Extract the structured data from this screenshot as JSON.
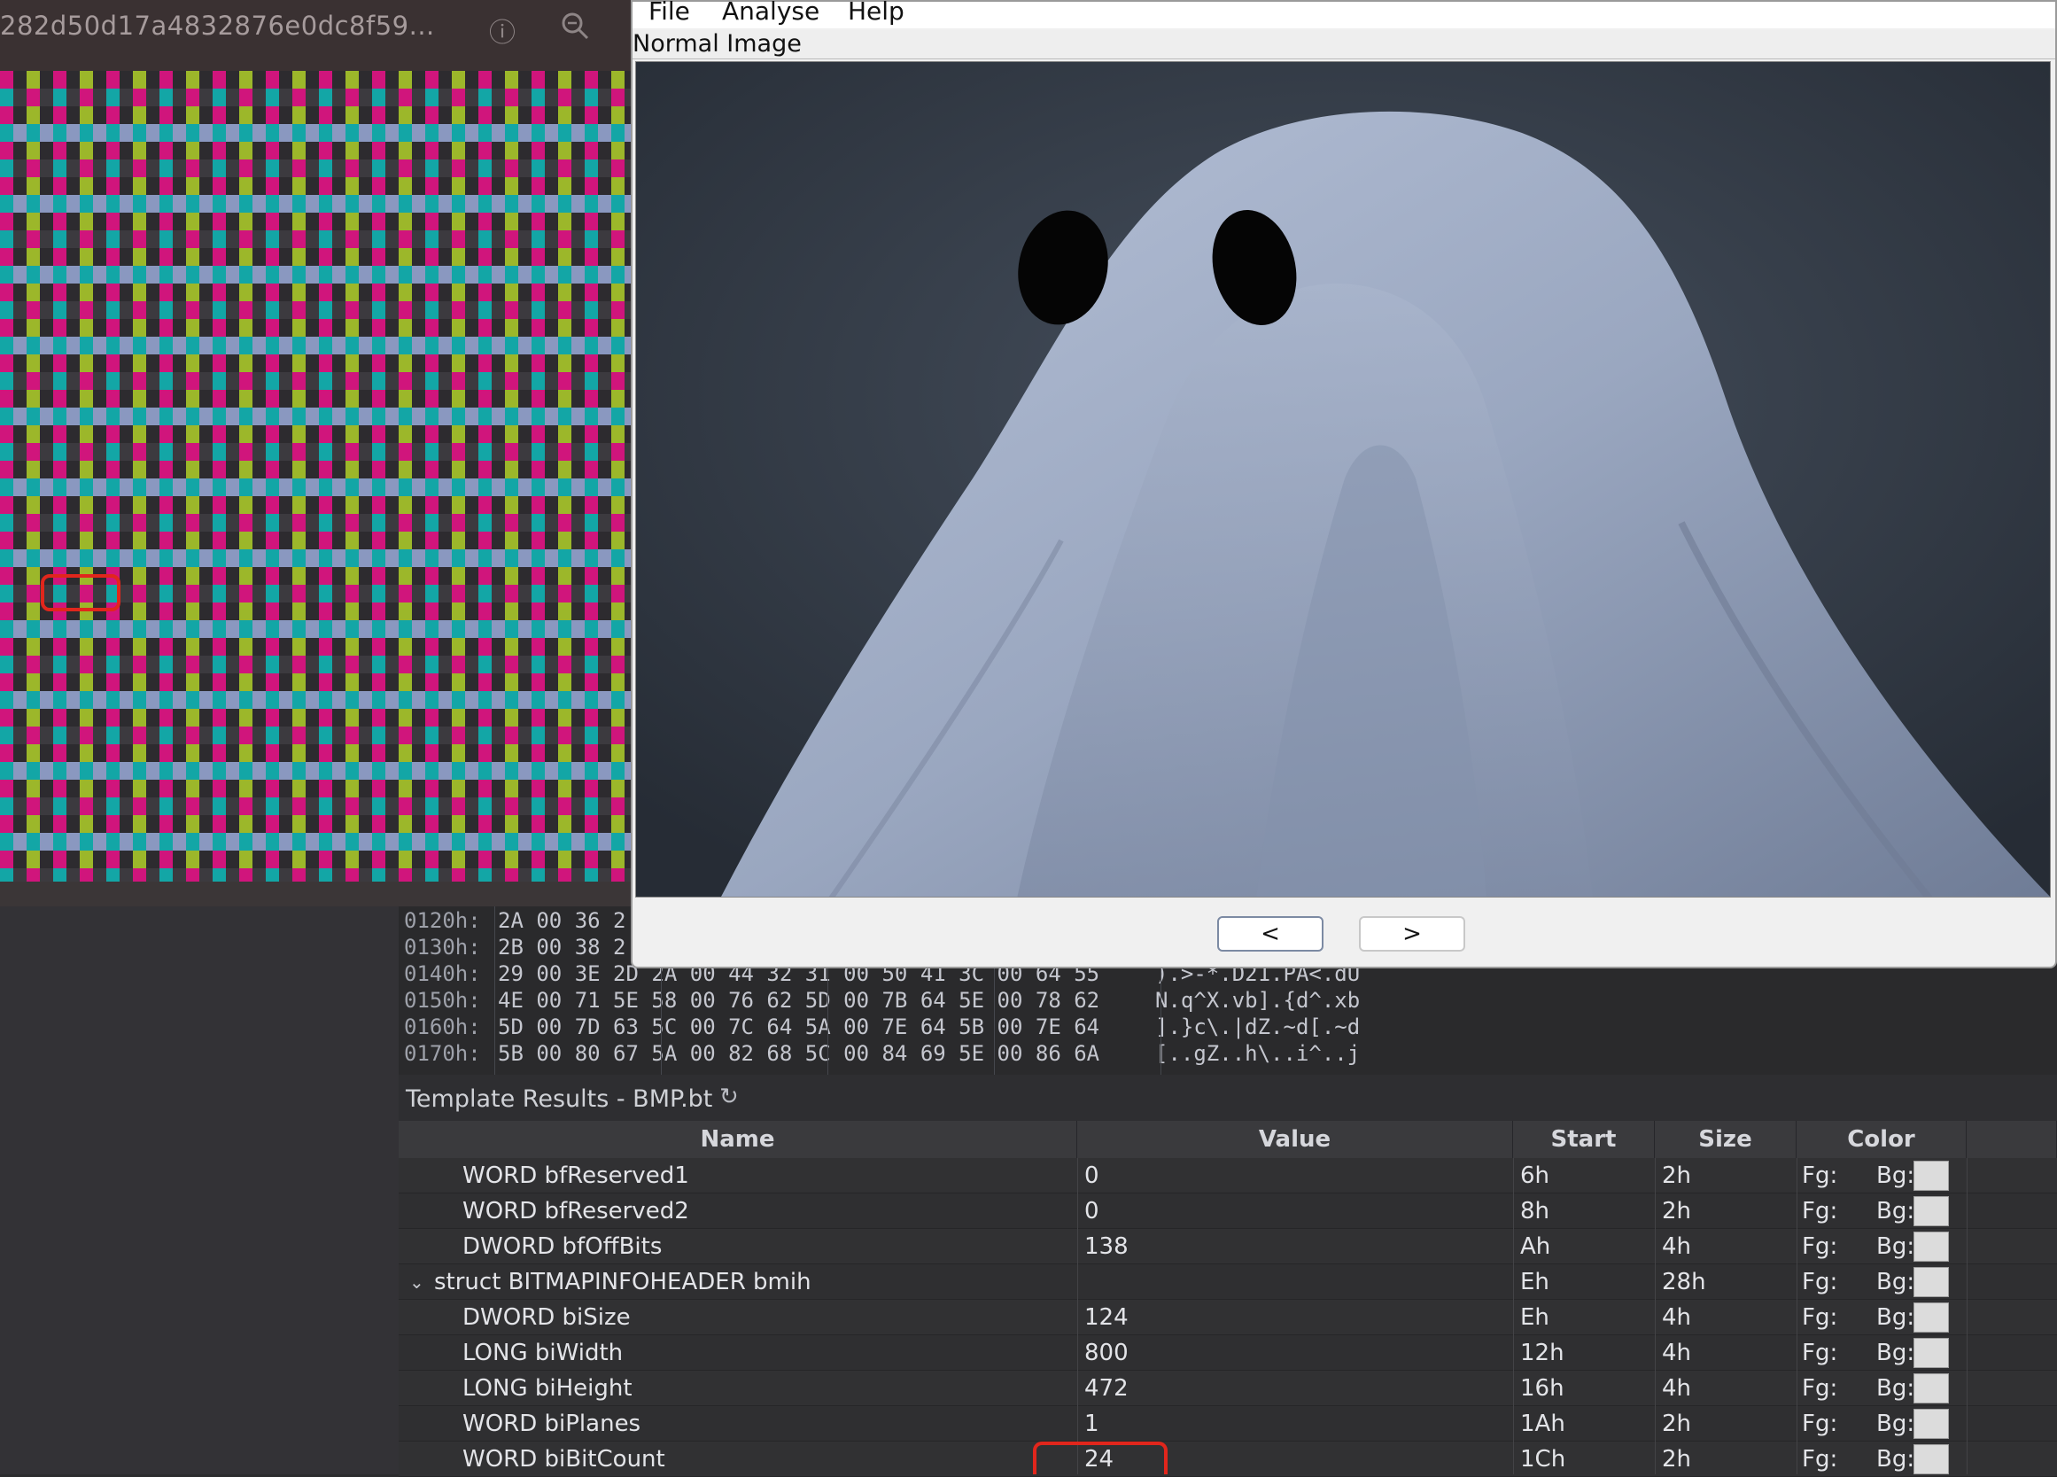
{
  "viewer": {
    "title": "282d50d17a4832876e0dc8f59...",
    "icons": [
      "info-icon",
      "zoom-icon"
    ],
    "pattern_colors": [
      "#d0157c",
      "#13a6a6",
      "#9cb72a",
      "#8a98c0",
      "#3a3a3a"
    ]
  },
  "app": {
    "menu": [
      "File",
      "Analyse",
      "Help"
    ],
    "image_label": "Normal Image",
    "prev_label": "<",
    "next_label": ">"
  },
  "hex": {
    "rows": [
      {
        "addr": "0120h:",
        "bytes": "2A 00 36 2",
        "ascii": ""
      },
      {
        "addr": "0130h:",
        "bytes": "2B 00 38 2",
        "ascii": ""
      },
      {
        "addr": "0140h:",
        "bytes": "29 00 3E 2D 2A 00 44 32 31 00 50 41 3C 00 64 55",
        "ascii": ").>-*.D21.PA<.dU"
      },
      {
        "addr": "0150h:",
        "bytes": "4E 00 71 5E 58 00 76 62 5D 00 7B 64 5E 00 78 62",
        "ascii": "N.q^X.vb].{d^.xb"
      },
      {
        "addr": "0160h:",
        "bytes": "5D 00 7D 63 5C 00 7C 64 5A 00 7E 64 5B 00 7E 64",
        "ascii": "].}c\\.|dZ.~d[.~d"
      },
      {
        "addr": "0170h:",
        "bytes": "5B 00 80 67 5A 00 82 68 5C 00 84 69 5E 00 86 6A",
        "ascii": "[..gZ..h\\..i^..j"
      }
    ]
  },
  "template": {
    "title": "Template Results - BMP.bt",
    "columns": [
      "Name",
      "Value",
      "Start",
      "Size",
      "Color"
    ],
    "rows": [
      {
        "name": "WORD bfReserved1",
        "value": "0",
        "start": "6h",
        "size": "2h",
        "fg": "Fg:",
        "bg": "Bg:",
        "indent": 1
      },
      {
        "name": "WORD bfReserved2",
        "value": "0",
        "start": "8h",
        "size": "2h",
        "fg": "Fg:",
        "bg": "Bg:",
        "indent": 1
      },
      {
        "name": "DWORD bfOffBits",
        "value": "138",
        "start": "Ah",
        "size": "4h",
        "fg": "Fg:",
        "bg": "Bg:",
        "indent": 1
      },
      {
        "name": "struct BITMAPINFOHEADER bmih",
        "value": "",
        "start": "Eh",
        "size": "28h",
        "fg": "Fg:",
        "bg": "Bg:",
        "indent": 0
      },
      {
        "name": "DWORD biSize",
        "value": "124",
        "start": "Eh",
        "size": "4h",
        "fg": "Fg:",
        "bg": "Bg:",
        "indent": 1
      },
      {
        "name": "LONG biWidth",
        "value": "800",
        "start": "12h",
        "size": "4h",
        "fg": "Fg:",
        "bg": "Bg:",
        "indent": 1
      },
      {
        "name": "LONG biHeight",
        "value": "472",
        "start": "16h",
        "size": "4h",
        "fg": "Fg:",
        "bg": "Bg:",
        "indent": 1
      },
      {
        "name": "WORD biPlanes",
        "value": "1",
        "start": "1Ah",
        "size": "2h",
        "fg": "Fg:",
        "bg": "Bg:",
        "indent": 1
      },
      {
        "name": "WORD biBitCount",
        "value": "24",
        "start": "1Ch",
        "size": "2h",
        "fg": "Fg:",
        "bg": "Bg:",
        "indent": 1
      }
    ]
  }
}
